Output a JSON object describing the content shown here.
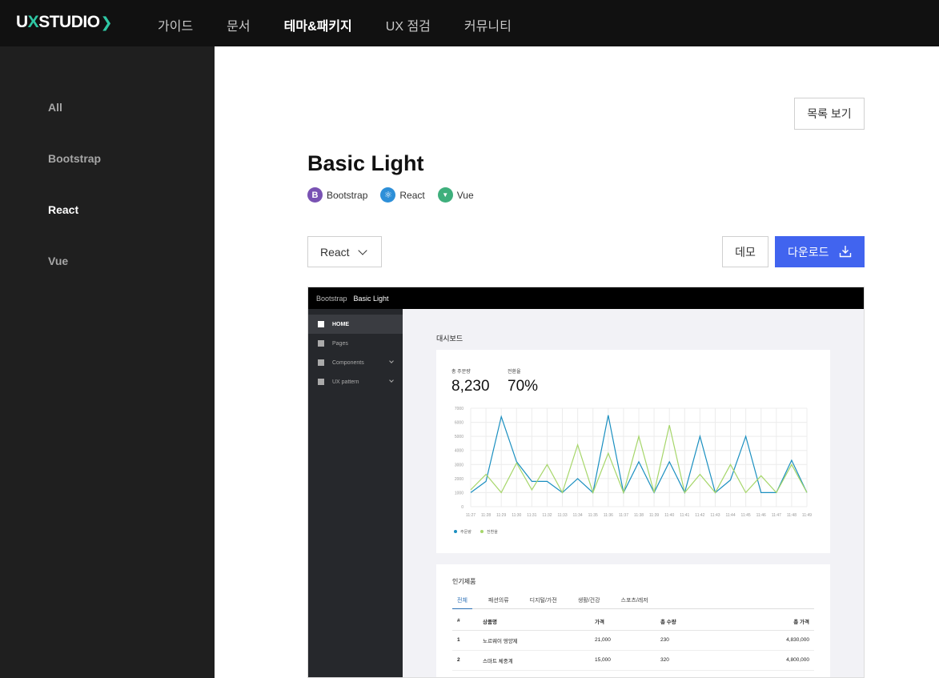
{
  "header": {
    "logo": {
      "ux": "U",
      "x": "X",
      "studio": "STUDIO",
      "chevron": "❯"
    },
    "menu": [
      {
        "label": "가이드",
        "active": false
      },
      {
        "label": "문서",
        "active": false
      },
      {
        "label": "테마&패키지",
        "active": true
      },
      {
        "label": "UX 점검",
        "active": false
      },
      {
        "label": "커뮤니티",
        "active": false
      }
    ]
  },
  "sidebar": {
    "items": [
      {
        "label": "All",
        "active": false
      },
      {
        "label": "Bootstrap",
        "active": false
      },
      {
        "label": "React",
        "active": true
      },
      {
        "label": "Vue",
        "active": false
      }
    ]
  },
  "main": {
    "list_button": "목록 보기",
    "title": "Basic Light",
    "tags": [
      {
        "icon": "B",
        "label": "Bootstrap"
      },
      {
        "icon": "⚛",
        "label": "React"
      },
      {
        "icon": "▼",
        "label": "Vue"
      }
    ],
    "framework_select": "React",
    "demo_button": "데모",
    "download_button": "다운로드"
  },
  "preview": {
    "topbar": {
      "brand": "Bootstrap",
      "name": "Basic Light"
    },
    "sidebar": [
      {
        "label": "HOME",
        "active": true,
        "icon": "home-icon",
        "expand": false
      },
      {
        "label": "Pages",
        "active": false,
        "icon": "table-icon",
        "expand": false
      },
      {
        "label": "Components",
        "active": false,
        "icon": "layers-icon",
        "expand": true
      },
      {
        "label": "UX pattern",
        "active": false,
        "icon": "pattern-icon",
        "expand": true
      }
    ],
    "dashboard_title": "대시보드",
    "kpis": [
      {
        "label": "총 주문량",
        "value": "8,230"
      },
      {
        "label": "전환율",
        "value": "70%"
      }
    ],
    "popular_title": "인기제품",
    "tabs": [
      {
        "label": "전체",
        "active": true
      },
      {
        "label": "패션의류",
        "active": false
      },
      {
        "label": "디지털/가전",
        "active": false
      },
      {
        "label": "생활/건강",
        "active": false
      },
      {
        "label": "스포츠/레저",
        "active": false
      }
    ],
    "table": {
      "columns": [
        "#",
        "상품명",
        "가격",
        "총 수량",
        "총 가격"
      ],
      "rows": [
        [
          "1",
          "노르웨이 영양제",
          "21,000",
          "230",
          "4,830,000"
        ],
        [
          "2",
          "스마트 체중계",
          "15,000",
          "320",
          "4,800,000"
        ]
      ]
    }
  },
  "chart_data": {
    "type": "line",
    "x": [
      "11:27",
      "11:28",
      "11:29",
      "11:30",
      "11:31",
      "11:32",
      "11:33",
      "11:34",
      "11:35",
      "11:36",
      "11:37",
      "11:38",
      "11:39",
      "11:40",
      "11:41",
      "11:42",
      "11:43",
      "11:44",
      "11:45",
      "11:46",
      "11:47",
      "11:48",
      "11:49"
    ],
    "ylim": [
      0,
      7000
    ],
    "yticks": [
      0,
      1000,
      2000,
      3000,
      4000,
      5000,
      6000,
      7000
    ],
    "series": [
      {
        "name": "주문량",
        "color": "#1a8fc0",
        "values": [
          1000,
          1800,
          6400,
          3200,
          1800,
          1800,
          1000,
          2000,
          1000,
          6500,
          1000,
          3200,
          1000,
          3200,
          1000,
          5000,
          1000,
          1900,
          5000,
          1000,
          1000,
          3300,
          1000
        ]
      },
      {
        "name": "전환율",
        "color": "#a6d66a",
        "values": [
          1200,
          2300,
          1000,
          3100,
          1200,
          3000,
          1000,
          4400,
          1000,
          3800,
          1000,
          5000,
          1000,
          5800,
          1000,
          2300,
          1000,
          3000,
          1000,
          2200,
          1000,
          3000,
          1000
        ]
      }
    ],
    "grid": true,
    "legend": "bottom-left"
  }
}
